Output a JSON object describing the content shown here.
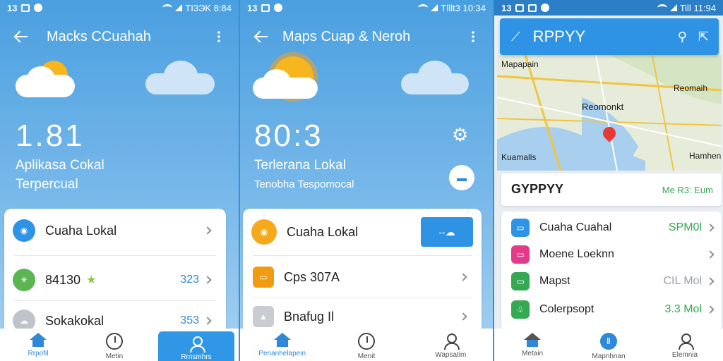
{
  "panel1": {
    "status": {
      "left": "13",
      "time": "TI3ЭK 8:84"
    },
    "title": "Macks CCuahah",
    "temp": "1.81",
    "line1": "Aplikasa Cokal",
    "line2": "Terpercual",
    "rows": [
      {
        "label": "Cuaha Lokal",
        "value": ""
      },
      {
        "label": "84130",
        "value": "323"
      },
      {
        "label": "Sokakokal",
        "value": "353"
      }
    ],
    "nav": [
      "Rrpofil",
      "Metin",
      "Rrnsmhrs"
    ]
  },
  "panel2": {
    "status": {
      "left": "13",
      "time": "Tlllt3 10:34"
    },
    "title": "Maps Cuap & Neroh",
    "temp": "80:3",
    "line1": "Terlerana Lokal",
    "line2": "Tenobha Tespomocal",
    "rows": [
      {
        "label": "Cuaha Lokal"
      },
      {
        "label": "Cps 307A"
      },
      {
        "label": "Bnafug Il"
      }
    ],
    "nav": [
      "Penanhelapein",
      "Menit",
      "Wapsatim"
    ]
  },
  "panel3": {
    "status": {
      "left": "13",
      "time": "Till 11:94"
    },
    "search_title": "RPPYY",
    "map_labels": [
      "Mapapain",
      "Reomaih",
      "Reomonkt",
      "Kuamalls",
      "Hamhen"
    ],
    "location": {
      "name": "GYPPYY",
      "detail": "Me R3: Eum"
    },
    "rows": [
      {
        "label": "Cuaha Cuahal",
        "value": "SPM0l",
        "color": "#2f93e5"
      },
      {
        "label": "Moene Loeknn",
        "value": "",
        "color": "#e33a8a"
      },
      {
        "label": "Mapst",
        "value": "CIL Mol",
        "color": "#34a853"
      },
      {
        "label": "Colerpsopt",
        "value": "3.3 Mol",
        "color": "#34a853"
      }
    ],
    "nav": [
      "Metain",
      "Mapnhnan",
      "Elemnia"
    ]
  }
}
